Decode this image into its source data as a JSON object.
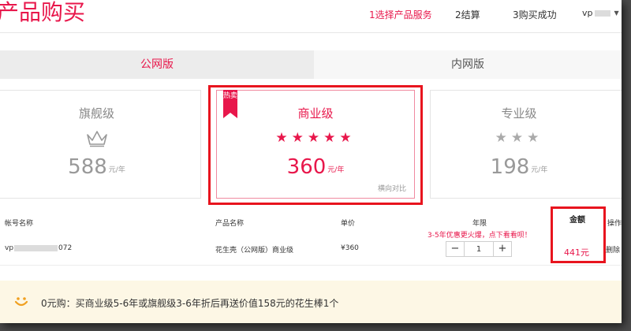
{
  "header": {
    "title": "产品购买",
    "steps": [
      {
        "label": "1选择产品服务",
        "active": true
      },
      {
        "label": "2结算",
        "active": false
      },
      {
        "label": "3购买成功",
        "active": false
      }
    ],
    "user_prefix": "vp"
  },
  "tabs": [
    {
      "label": "公网版",
      "active": true
    },
    {
      "label": "内网版",
      "active": false
    }
  ],
  "plans": {
    "flagship": {
      "name": "旗舰级",
      "price": "588",
      "unit": "元/年",
      "icon": "crown-icon"
    },
    "business": {
      "name": "商业级",
      "price": "360",
      "unit": "元/年",
      "stars": "★★★★★",
      "star_count": 5,
      "hot_badge": "热卖",
      "compare": "横向对比"
    },
    "pro": {
      "name": "专业级",
      "price": "198",
      "unit": "元/年",
      "stars": "★★★",
      "star_count": 3
    }
  },
  "table": {
    "headers": {
      "account": "帐号名称",
      "product": "产品名称",
      "price": "单价",
      "term": "年限",
      "total": "金额",
      "operation": "操作"
    },
    "promo": "3-5年优惠更火爆，点下看看呗！",
    "row": {
      "account_prefix": "vp",
      "account_suffix": "072",
      "product": "花生壳（公网版）商业级",
      "price": "¥360",
      "quantity": "1",
      "minus": "−",
      "plus": "+",
      "total": "441元",
      "delete": "删除"
    }
  },
  "notice": {
    "text": "0元购：买商业级5-6年或旗舰级3-6年折后再送价值158元的花生棒1个"
  },
  "colors": {
    "accent": "#e8174b",
    "highlight": "#e8141e",
    "notice_bg": "#fdf7e5"
  }
}
